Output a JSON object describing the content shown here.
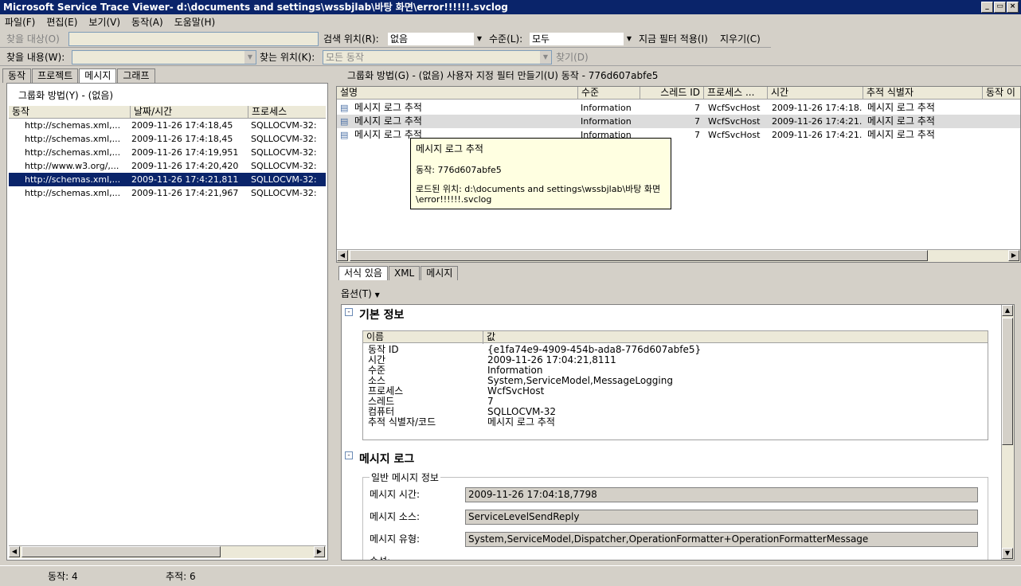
{
  "window": {
    "title": "Microsoft Service Trace Viewer- d:\\documents and settings\\wssbjlab\\바탕 화면\\error!!!!!!.svclog",
    "minimize_glyph": "_",
    "maximize_glyph": "▭",
    "close_glyph": "×"
  },
  "menu": [
    "파일(F)",
    "편집(E)",
    "보기(V)",
    "동작(A)",
    "도움말(H)"
  ],
  "toolbar1": {
    "find_target_label": "찾을 대상(O)",
    "find_target_value": "",
    "search_location_label": "검색 위치(R):",
    "search_location_value": "없음",
    "level_label": "수준(L):",
    "level_value": "모두",
    "apply_filter_label": "지금 필터 적용(I)",
    "clear_label": "지우기(C)"
  },
  "toolbar2": {
    "find_content_label": "찾을 내용(W):",
    "find_content_value": "",
    "find_where_label": "찾는 위치(K):",
    "find_where_value": "모든 동작",
    "find_button": "찾기(D)"
  },
  "left_tabs": [
    "동작",
    "프로젝트",
    "메시지",
    "그래프"
  ],
  "left_panel": {
    "group_by": "그룹화 방법(Y) - (없음)",
    "columns": [
      "동작",
      "날짜/시간",
      "프로세스"
    ],
    "rows": [
      [
        "http://schemas.xml,...",
        "2009-11-26  17:4:18,45",
        "SQLLOCVM-32:"
      ],
      [
        "http://schemas.xml,...",
        "2009-11-26  17:4:18,45",
        "SQLLOCVM-32:"
      ],
      [
        "http://schemas.xml,...",
        "2009-11-26  17:4:19,951",
        "SQLLOCVM-32:"
      ],
      [
        "http://www.w3.org/,...",
        "2009-11-26  17:4:20,420",
        "SQLLOCVM-32:"
      ],
      [
        "http://schemas.xml,...",
        "2009-11-26  17:4:21,811",
        "SQLLOCVM-32:"
      ],
      [
        "http://schemas.xml,...",
        "2009-11-26  17:4:21,967",
        "SQLLOCVM-32:"
      ]
    ],
    "selected_row": 4
  },
  "right_top": {
    "header_text": "그룹화 방법(G) - (없음)   사용자 지정 필터 만들기(U)  동작 - 776d607abfe5",
    "columns": [
      "설명",
      "수준",
      "스레드 ID",
      "프로세스 ...",
      "시간",
      "추적 식별자",
      "동작 이"
    ],
    "rows": [
      [
        "메시지 로그 추적",
        "Information",
        "7",
        "WcfSvcHost",
        "2009-11-26 17:4:18....",
        "메시지 로그 추적"
      ],
      [
        "메시지 로그 추적",
        "Information",
        "7",
        "WcfSvcHost",
        "2009-11-26 17:4:21....",
        "메시지 로그 추적"
      ],
      [
        "메시지 로그 추적",
        "Information",
        "7",
        "WcfSvcHost",
        "2009-11-26 17:4:21....",
        "메시지 로그 추적"
      ]
    ]
  },
  "tooltip": {
    "title": "메시지 로그 추적",
    "activity": "동작: 776d607abfe5",
    "loaded_from": "로드된 위치: d:\\documents and settings\\wssbjlab\\바탕 화면\\error!!!!!!.svclog"
  },
  "detail_tabs": [
    "서식 있음",
    "XML",
    "메시지"
  ],
  "options_label": "옵션(T)",
  "basic_info": {
    "heading": "기본 정보",
    "columns": [
      "이름",
      "값"
    ],
    "rows": [
      [
        "동작 ID",
        "{e1fa74e9-4909-454b-ada8-776d607abfe5}"
      ],
      [
        "시간",
        "2009-11-26 17:04:21,8111"
      ],
      [
        "수준",
        "Information"
      ],
      [
        "소스",
        "System,ServiceModel,MessageLogging"
      ],
      [
        "프로세스",
        "WcfSvcHost"
      ],
      [
        "스레드",
        "7"
      ],
      [
        "컴퓨터",
        "SQLLOCVM-32"
      ],
      [
        "추적 식별자/코드",
        "메시지 로그 추적"
      ]
    ]
  },
  "message_log": {
    "heading": "메시지 로그",
    "group_title": "일반 메시지 정보",
    "fields": [
      {
        "label": "메시지 시간:",
        "value": "2009-11-26 17:04:18,7798"
      },
      {
        "label": "메시지 소스:",
        "value": "ServiceLevelSendReply"
      },
      {
        "label": "메시지 유형:",
        "value": "System,ServiceModel,Dispatcher,OperationFormatter+OperationFormatterMessage"
      }
    ],
    "next_label": "속성:"
  },
  "status": {
    "activities": "동작: 4",
    "traces": "추적: 6"
  }
}
